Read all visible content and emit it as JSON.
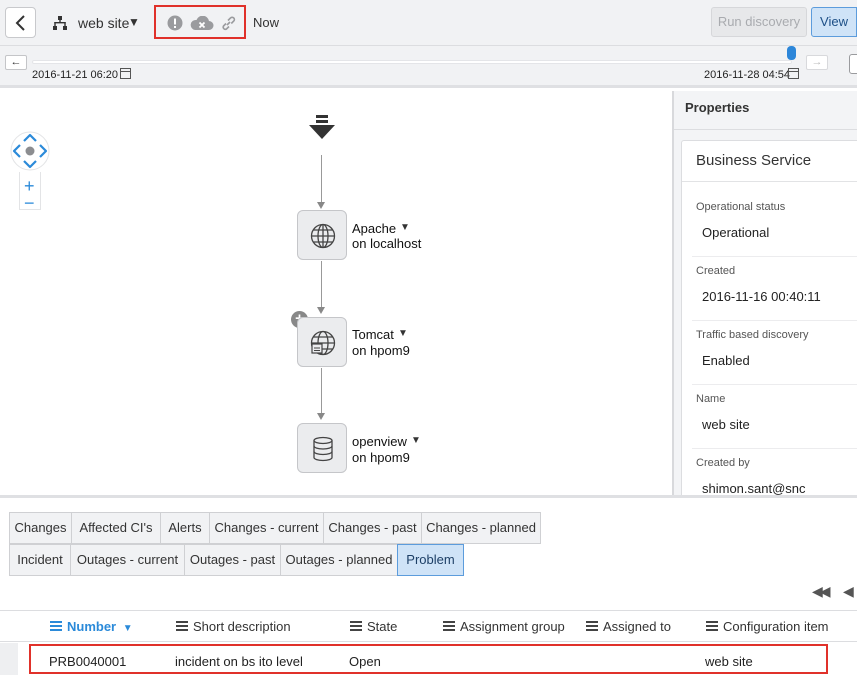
{
  "toolbar": {
    "service_title": "web site",
    "now_label": "Now",
    "run_discovery_label": "Run discovery",
    "view_label": "View"
  },
  "timeline": {
    "start_date": "2016-11-21 06:20",
    "end_date": "2016-11-28 04:54",
    "position_fraction": 1.0
  },
  "map": {
    "nodes": [
      {
        "name": "Apache",
        "host": "on localhost",
        "icon": "globe-icon"
      },
      {
        "name": "Tomcat",
        "host": "on hpom9",
        "icon": "app-server-icon"
      },
      {
        "name": "openview",
        "host": "on hpom9",
        "icon": "database-icon"
      }
    ]
  },
  "properties": {
    "header": "Properties",
    "card_title": "Business Service",
    "fields": [
      {
        "label": "Operational status",
        "value": "Operational"
      },
      {
        "label": "Created",
        "value": "2016-11-16 00:40:11"
      },
      {
        "label": "Traffic based discovery",
        "value": "Enabled"
      },
      {
        "label": "Name",
        "value": "web site"
      },
      {
        "label": "Created by",
        "value": "shimon.sant@snc"
      }
    ]
  },
  "tabs": {
    "row1": [
      "Changes",
      "Affected CI's",
      "Alerts",
      "Changes - current",
      "Changes - past",
      "Changes - planned"
    ],
    "row2": [
      "Incident",
      "Outages - current",
      "Outages - past",
      "Outages - planned",
      "Problem"
    ],
    "active": "Problem"
  },
  "table": {
    "columns": [
      "Number",
      "Short description",
      "State",
      "Assignment group",
      "Assigned to",
      "Configuration item"
    ],
    "sorted_column": "Number",
    "rows": [
      {
        "number": "PRB0040001",
        "short_description": "incident on bs ito level",
        "state": "Open",
        "assignment_group": "",
        "assigned_to": "",
        "configuration_item": "web site"
      }
    ]
  },
  "colors": {
    "accent": "#2b8ad9",
    "highlight_border": "#e0312a",
    "active_tab": "#cfe3f7"
  }
}
